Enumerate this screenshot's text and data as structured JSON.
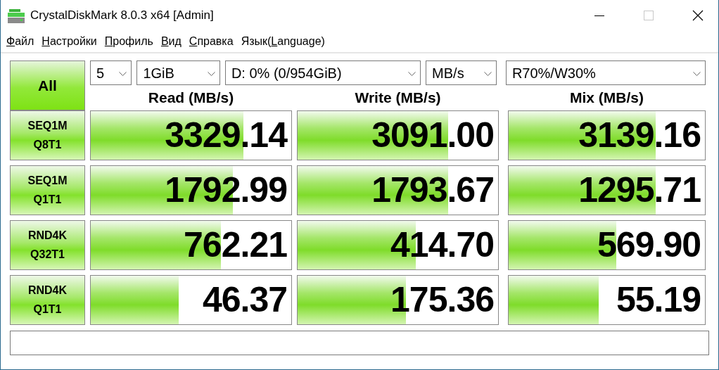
{
  "window": {
    "title": "CrystalDiskMark 8.0.3 x64 [Admin]",
    "maximize_disabled": true
  },
  "menu": [
    {
      "key": "Ф",
      "post": "айл"
    },
    {
      "key": "Н",
      "post": "астройки"
    },
    {
      "key": "П",
      "post": "рофиль"
    },
    {
      "key": "В",
      "post": "ид"
    },
    {
      "key": "С",
      "post": "правка"
    },
    {
      "pre": "Язык(",
      "key": "L",
      "post": "anguage)"
    }
  ],
  "all_button": "All",
  "selectors": [
    {
      "value": "5"
    },
    {
      "value": "1GiB"
    },
    {
      "value": "D: 0% (0/954GiB)"
    },
    {
      "value": "MB/s"
    },
    {
      "value": "R70%/W30%"
    }
  ],
  "columns": [
    "Read (MB/s)",
    "Write (MB/s)",
    "Mix (MB/s)"
  ],
  "tests": [
    {
      "label": [
        "SEQ1M",
        "Q8T1"
      ],
      "results": [
        {
          "value": "3329.14",
          "level": 0.76
        },
        {
          "value": "3091.00",
          "level": 0.75
        },
        {
          "value": "3139.16",
          "level": 0.75
        }
      ]
    },
    {
      "label": [
        "SEQ1M",
        "Q1T1"
      ],
      "results": [
        {
          "value": "1792.99",
          "level": 0.71
        },
        {
          "value": "1793.67",
          "level": 0.75
        },
        {
          "value": "1295.71",
          "level": 0.75
        }
      ]
    },
    {
      "label": [
        "RND4K",
        "Q32T1"
      ],
      "results": [
        {
          "value": "762.21",
          "level": 0.65
        },
        {
          "value": "414.70",
          "level": 0.59
        },
        {
          "value": "569.90",
          "level": 0.55
        }
      ]
    },
    {
      "label": [
        "RND4K",
        "Q1T1"
      ],
      "results": [
        {
          "value": "46.37",
          "level": 0.44
        },
        {
          "value": "175.36",
          "level": 0.54
        },
        {
          "value": "55.19",
          "level": 0.46
        }
      ]
    }
  ]
}
